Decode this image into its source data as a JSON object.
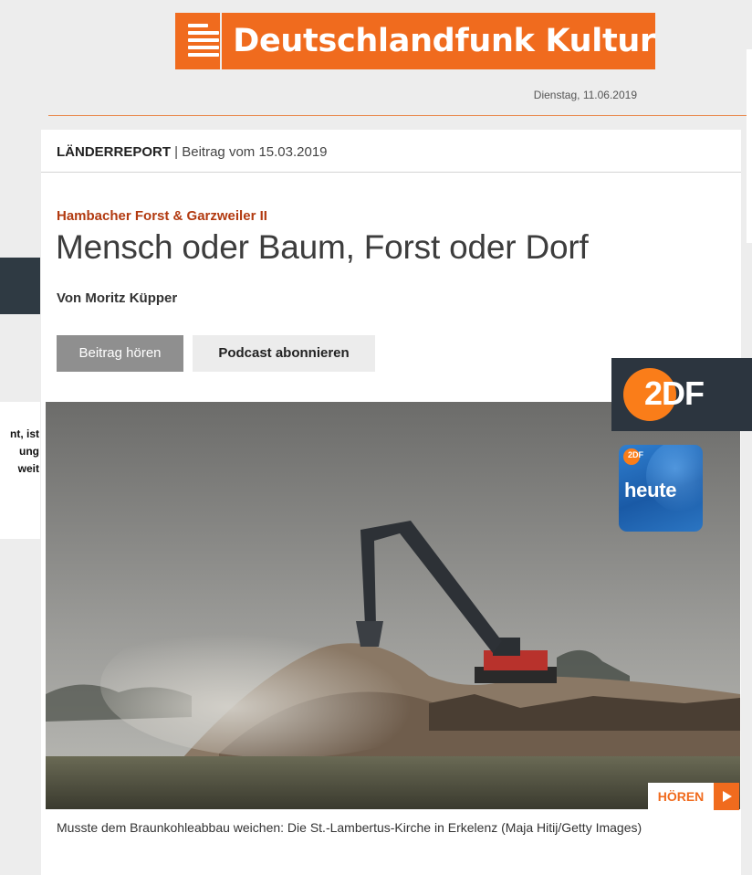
{
  "header": {
    "logo_text": "Deutschlandfunk Kultur",
    "brand_color": "#f06b1e",
    "date": "Dienstag, 11.06.2019"
  },
  "left_fragment": {
    "lines": [
      "nt, ist",
      "ung",
      "weit"
    ]
  },
  "article": {
    "overline_program": "LÄNDERREPORT",
    "overline_sep": " | ",
    "overline_date": "Beitrag vom 15.03.2019",
    "kicker": "Hambacher Forst & Garzweiler II",
    "headline": "Mensch oder Baum, Forst oder Dorf",
    "author": "Von Moritz Küpper",
    "buttons": {
      "listen": "Beitrag hören",
      "podcast": "Podcast abonnieren"
    },
    "photo": {
      "alt": "Musste dem Braunkohleabbau weichen: Die St.-Lambertus-Kirche in Erkelenz",
      "listen_label": "HÖREN"
    },
    "caption": "Musste dem Braunkohleabbau weichen: Die St.-Lambertus-Kirche in Erkelenz (Maja Hitij/Getty Images)"
  },
  "overlays": {
    "zdf_logo": "2DF",
    "zdf_color": "#fa7d19",
    "heute_small": "2DF",
    "heute_title": "heute"
  }
}
